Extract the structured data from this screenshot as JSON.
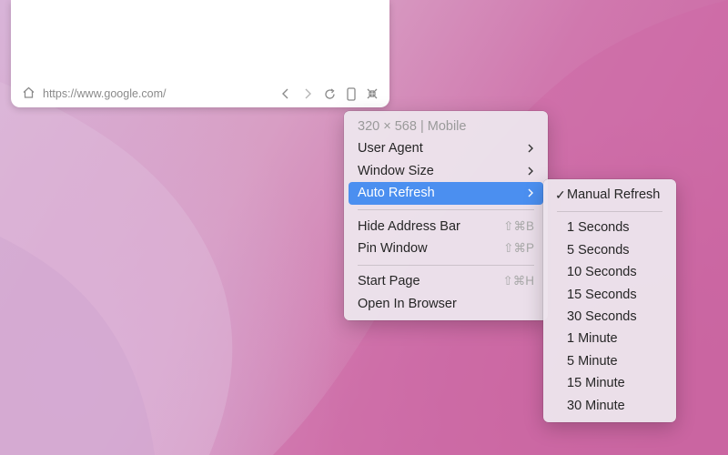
{
  "browser": {
    "url": "https://www.google.com/",
    "icons": [
      "home-icon",
      "back-icon",
      "forward-icon",
      "reload-icon",
      "device-icon",
      "collapse-icon"
    ]
  },
  "context_menu": {
    "header": "320 × 568 | Mobile",
    "items": [
      {
        "label": "User Agent",
        "submenu": true
      },
      {
        "label": "Window Size",
        "submenu": true
      },
      {
        "label": "Auto Refresh",
        "submenu": true,
        "highlighted": true
      },
      {
        "label": "Hide Address Bar",
        "shortcut": "⇧⌘B"
      },
      {
        "label": "Pin Window",
        "shortcut": "⇧⌘P"
      },
      {
        "label": "Start Page",
        "shortcut": "⇧⌘H"
      },
      {
        "label": "Open In Browser"
      }
    ],
    "submenu_arrow": ">"
  },
  "refresh_submenu": {
    "checkmark": "✓",
    "selected": "Manual Refresh",
    "options": [
      "1 Seconds",
      "5 Seconds",
      "10 Seconds",
      "15 Seconds",
      "30 Seconds",
      "1 Minute",
      "5 Minute",
      "15 Minute",
      "30 Minute"
    ]
  },
  "colors": {
    "highlight": "#4b8ff0",
    "wallpaper_pink": "#c9619f",
    "wallpaper_lilac": "#d8b4d8"
  }
}
